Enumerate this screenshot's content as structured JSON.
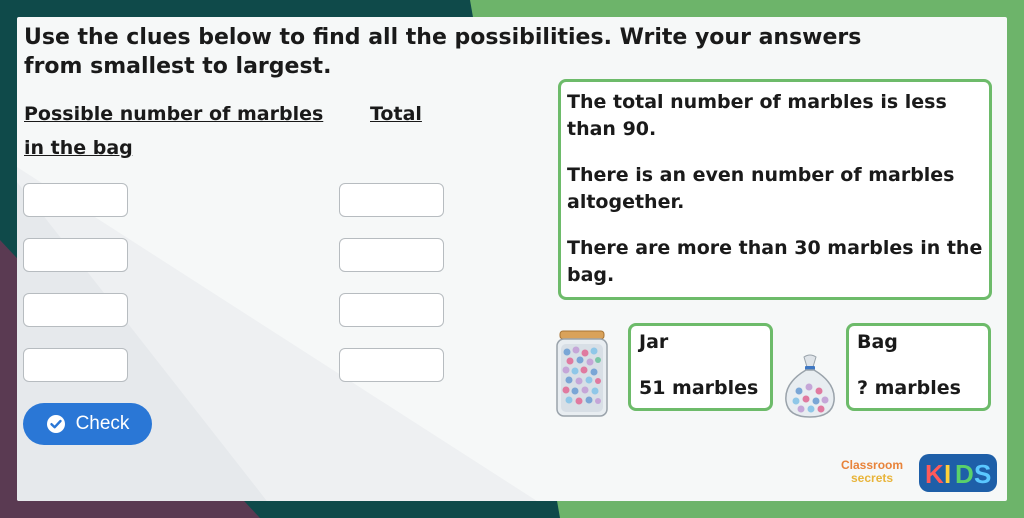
{
  "instruction": "Use the clues below to find all the possibilities. Write your answers from smallest to largest.",
  "columns": {
    "left_label": "Possible number of marbles in the bag",
    "right_label": "Total"
  },
  "answers": {
    "marbles": [
      "",
      "",
      "",
      ""
    ],
    "totals": [
      "",
      "",
      "",
      ""
    ]
  },
  "check_button": {
    "label": "Check"
  },
  "clues": [
    "The total number of marbles is less than 90.",
    "There is an even number of marbles altogether.",
    "There are more than 30 marbles in the bag."
  ],
  "jar": {
    "title": "Jar",
    "value": "51 marbles"
  },
  "bag": {
    "title": "Bag",
    "value": "? marbles"
  },
  "logo": {
    "brand": "Classroom Secrets",
    "kids": "KIDS"
  },
  "colors": {
    "accent_green": "#6dbb6a",
    "button_blue": "#2a77d6",
    "bg_dark_teal": "#0f4a4a"
  }
}
